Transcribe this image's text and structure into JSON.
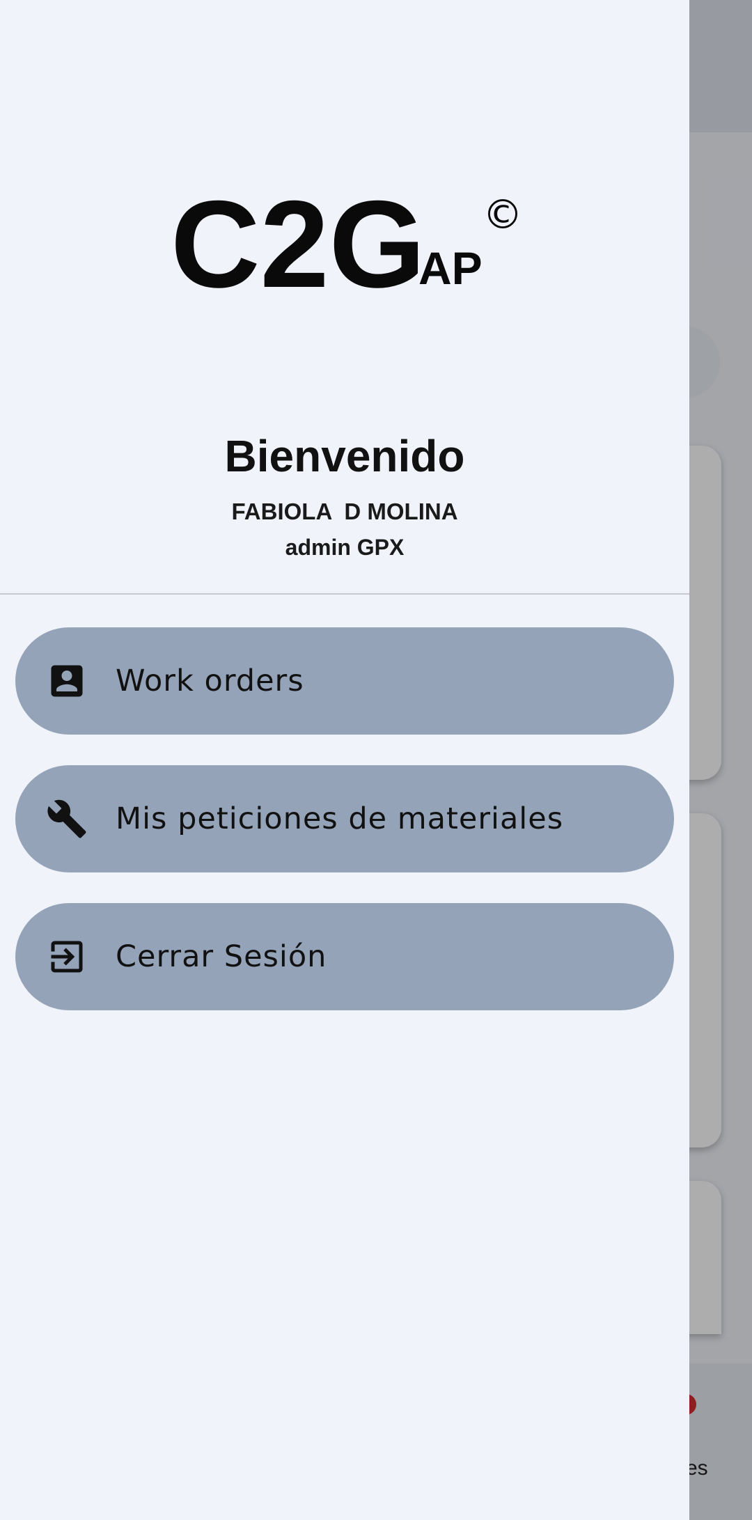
{
  "background": {
    "partial_nav_label": "es"
  },
  "drawer": {
    "logo": {
      "main_text": "C2G",
      "sub_text": "AP",
      "mark": "©"
    },
    "welcome": "Bienvenido",
    "user_name": "FABIOLA  D MOLINA",
    "user_role": "admin GPX",
    "menu": [
      {
        "label": "Work orders",
        "icon": "contact-card-icon"
      },
      {
        "label": "Mis peticiones de materiales",
        "icon": "wrench-icon"
      },
      {
        "label": "Cerrar Sesión",
        "icon": "logout-icon"
      }
    ]
  },
  "colors": {
    "drawer_background": "#f0f3fa",
    "menu_item_background": "#94a3b8",
    "scrim": "rgba(0,0,0,0.32)",
    "badge": "#d32f2f"
  }
}
